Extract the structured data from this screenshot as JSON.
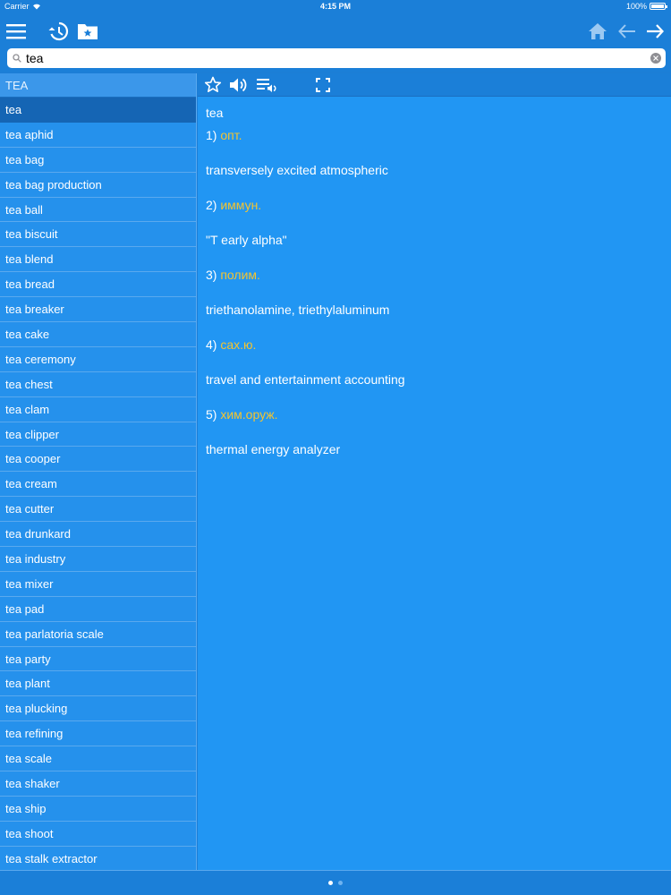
{
  "status_bar": {
    "carrier": "Carrier",
    "time": "4:15 PM",
    "battery": "100%"
  },
  "toolbar": {
    "menu_icon": "hamburger-icon",
    "history_icon": "history-icon",
    "favorites_icon": "favorites-folder-icon",
    "home_icon": "home-icon",
    "back_icon": "arrow-left-icon",
    "forward_icon": "arrow-right-icon"
  },
  "search": {
    "value": "tea",
    "placeholder": ""
  },
  "word_list": {
    "header": "TEA",
    "selected_index": 0,
    "items": [
      "tea",
      "tea aphid",
      "tea bag",
      "tea bag production",
      "tea ball",
      "tea biscuit",
      "tea blend",
      "tea bread",
      "tea breaker",
      "tea cake",
      "tea ceremony",
      "tea chest",
      "tea clam",
      "tea clipper",
      "tea cooper",
      "tea cream",
      "tea cutter",
      "tea drunkard",
      "tea industry",
      "tea mixer",
      "tea pad",
      "tea parlatoria scale",
      "tea party",
      "tea plant",
      "tea plucking",
      "tea refining",
      "tea scale",
      "tea shaker",
      "tea ship",
      "tea shoot",
      "tea stalk extractor"
    ]
  },
  "article": {
    "headword": "tea",
    "entries": [
      {
        "num": "1)",
        "tag": "опт.",
        "definition": "transversely excited atmospheric"
      },
      {
        "num": "2)",
        "tag": "иммун.",
        "definition": "\"T early alpha\""
      },
      {
        "num": "3)",
        "tag": "полим.",
        "definition": "triethanolamine, triethylaluminum"
      },
      {
        "num": "4)",
        "tag": "сах.ю.",
        "definition": "travel and entertainment accounting"
      },
      {
        "num": "5)",
        "tag": "хим.оруж.",
        "definition": "thermal energy analyzer"
      }
    ]
  },
  "colors": {
    "toolbar": "#1b7fd8",
    "content_bg": "#2196f3",
    "list_bg": "#2591ec",
    "selected_row": "#1565b4",
    "tag": "#f4c430"
  },
  "pager": {
    "pages": 2,
    "current": 1
  }
}
